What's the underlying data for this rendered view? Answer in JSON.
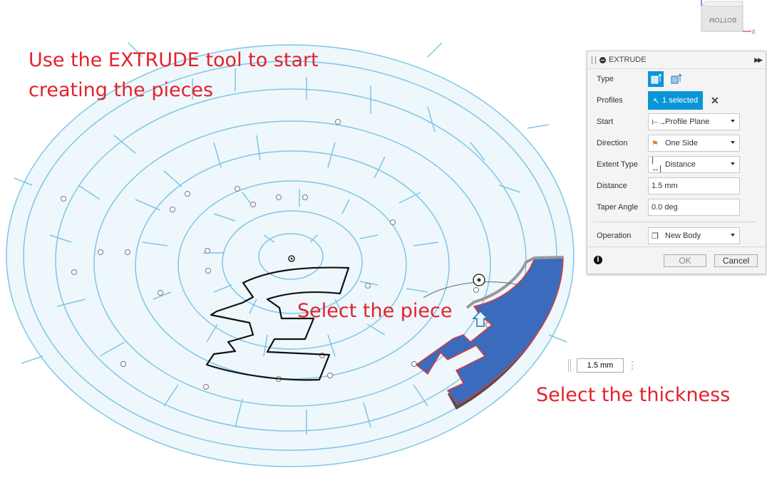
{
  "annotations": {
    "tool_hint_line1": "Use the EXTRUDE tool to start",
    "tool_hint_line2": "creating the pieces",
    "select_piece": "Select the piece",
    "select_thickness": "Select the thickness"
  },
  "viewcube": {
    "face_label": "BOTTOM",
    "axis_label": "X"
  },
  "panel": {
    "title": "EXTRUDE",
    "rows": {
      "type": {
        "label": "Type"
      },
      "profiles": {
        "label": "Profiles",
        "value": "1 selected"
      },
      "start": {
        "label": "Start",
        "value": "Profile Plane"
      },
      "direction": {
        "label": "Direction",
        "value": "One Side"
      },
      "extent_type": {
        "label": "Extent Type",
        "value": "Distance"
      },
      "distance": {
        "label": "Distance",
        "value": "1.5 mm"
      },
      "taper_angle": {
        "label": "Taper Angle",
        "value": "0.0 deg"
      },
      "operation": {
        "label": "Operation",
        "value": "New Body"
      }
    },
    "ok_label": "OK",
    "cancel_label": "Cancel"
  },
  "manipulator": {
    "value": "1.5 mm"
  },
  "colors": {
    "maze_stroke": "#7ec6e4",
    "maze_fill": "#eef7fc",
    "annotation": "#e4212b",
    "selection": "#3a6bbd",
    "accent": "#0a96d6"
  }
}
